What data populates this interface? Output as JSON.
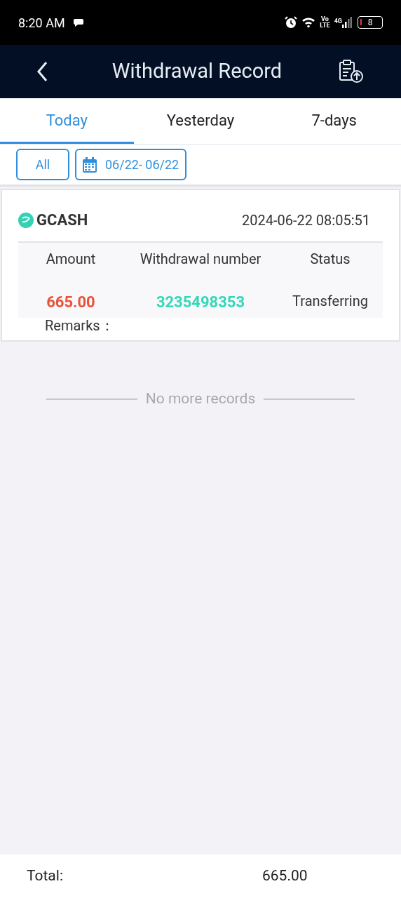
{
  "status_bar": {
    "time": "8:20 AM",
    "volte_top": "Vo",
    "volte_bottom": "LTE",
    "network": "4G",
    "battery": "8"
  },
  "header": {
    "title": "Withdrawal Record"
  },
  "tabs": [
    {
      "label": "Today",
      "selected": true
    },
    {
      "label": "Yesterday",
      "selected": false
    },
    {
      "label": "7-days",
      "selected": false
    }
  ],
  "filters": {
    "type": "All",
    "date_range": "06/22- 06/22"
  },
  "records": [
    {
      "method": "GCASH",
      "datetime": "2024-06-22 08:05:51",
      "columns": [
        "Amount",
        "Withdrawal number",
        "Status"
      ],
      "amount": "665.00",
      "number": "3235498353",
      "status": "Transferring",
      "remarks_label": "Remarks："
    }
  ],
  "end_note": "No more records",
  "footer": {
    "label": "Total:",
    "value": "665.00"
  }
}
